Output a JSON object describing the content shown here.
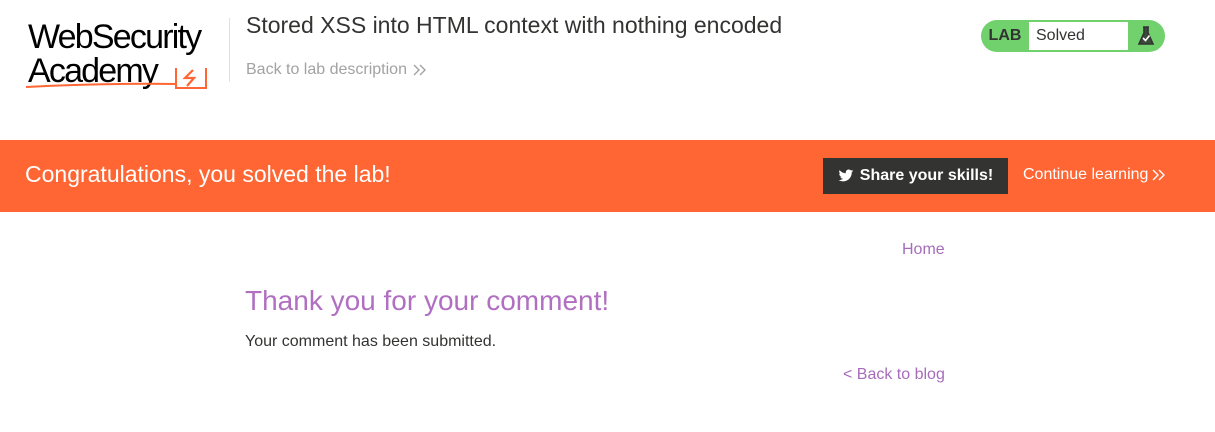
{
  "header": {
    "logo_line1": "WebSecurity",
    "logo_line2": "Academy",
    "lab_title": "Stored XSS into HTML context with nothing encoded",
    "back_to_description": "Back to lab description",
    "status_label": "LAB",
    "status_value": "Solved"
  },
  "banner": {
    "message": "Congratulations, you solved the lab!",
    "share_label": "Share your skills!",
    "continue_label": "Continue learning"
  },
  "content": {
    "home_link": "Home",
    "heading": "Thank you for your comment!",
    "message": "Your comment has been submitted.",
    "back_to_blog": "< Back to blog"
  },
  "colors": {
    "brand_orange": "#ff6633",
    "status_green": "#70d16d",
    "link_purple": "#a66cbb",
    "dark": "#333332"
  },
  "icons": {
    "logo_mark": "lightning-bolt-icon",
    "back_chevron": "double-chevron-right-icon",
    "status_icon": "flask-icon",
    "share_icon": "twitter-icon",
    "continue_chevron": "double-chevron-right-icon"
  }
}
